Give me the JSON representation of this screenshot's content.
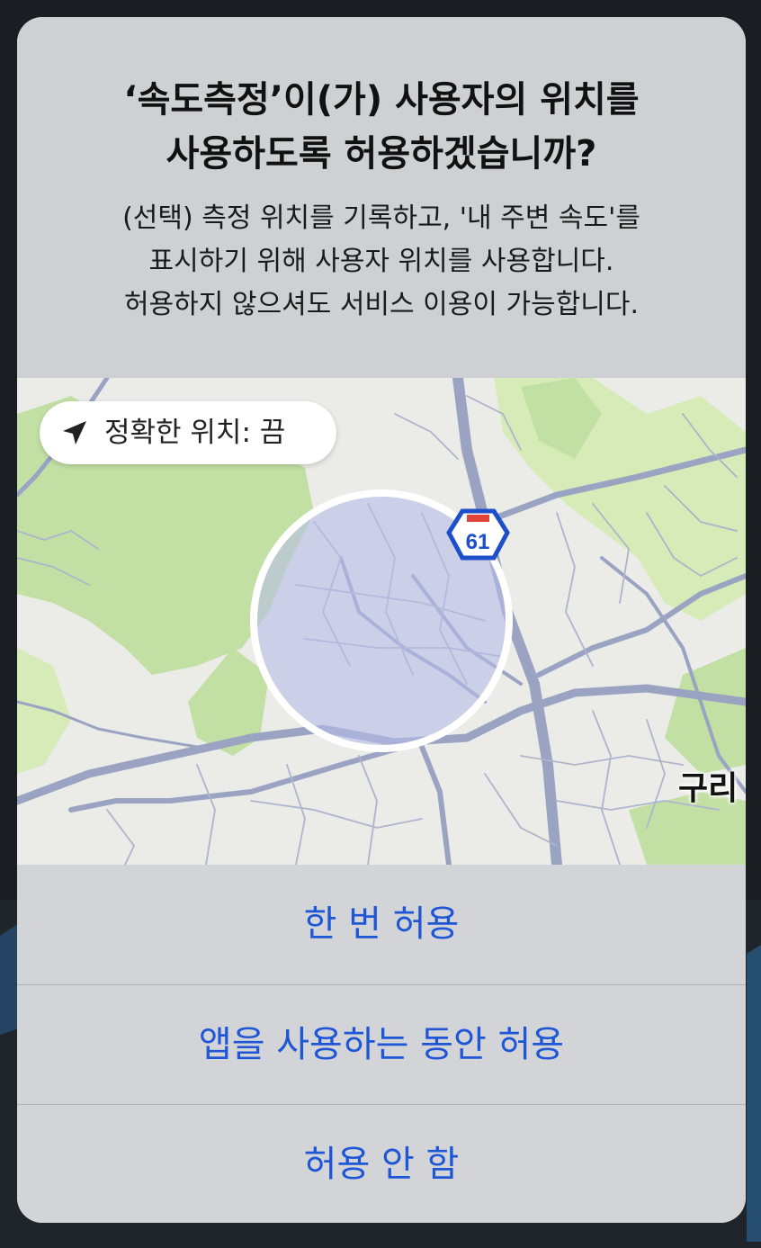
{
  "dialog": {
    "title_lines": [
      "‘속도측정’이(가) 사용자의 위치를",
      "사용하도록 허용하겠습니까?"
    ],
    "message_lines": [
      "(선택) 측정 위치를 기록하고, '내 주변 속도'를",
      "표시하기 위해 사용자 위치를 사용합니다.",
      "허용하지 않으셔도 서비스 이용이 가능합니다."
    ]
  },
  "map": {
    "precise_location_label": "정확한 위치: 끔",
    "highway_shield_number": "61",
    "city_label": "구리",
    "accuracy_circle_color": "#b7bde8",
    "park_color": "#c3e0a4",
    "road_color": "#9aa3c2"
  },
  "buttons": {
    "allow_once": "한 번 허용",
    "allow_while_using": "앱을 사용하는 동안 허용",
    "dont_allow": "허용 안 함"
  },
  "colors": {
    "button_text": "#1f56d6",
    "dialog_bg": "#d1d2d6"
  }
}
